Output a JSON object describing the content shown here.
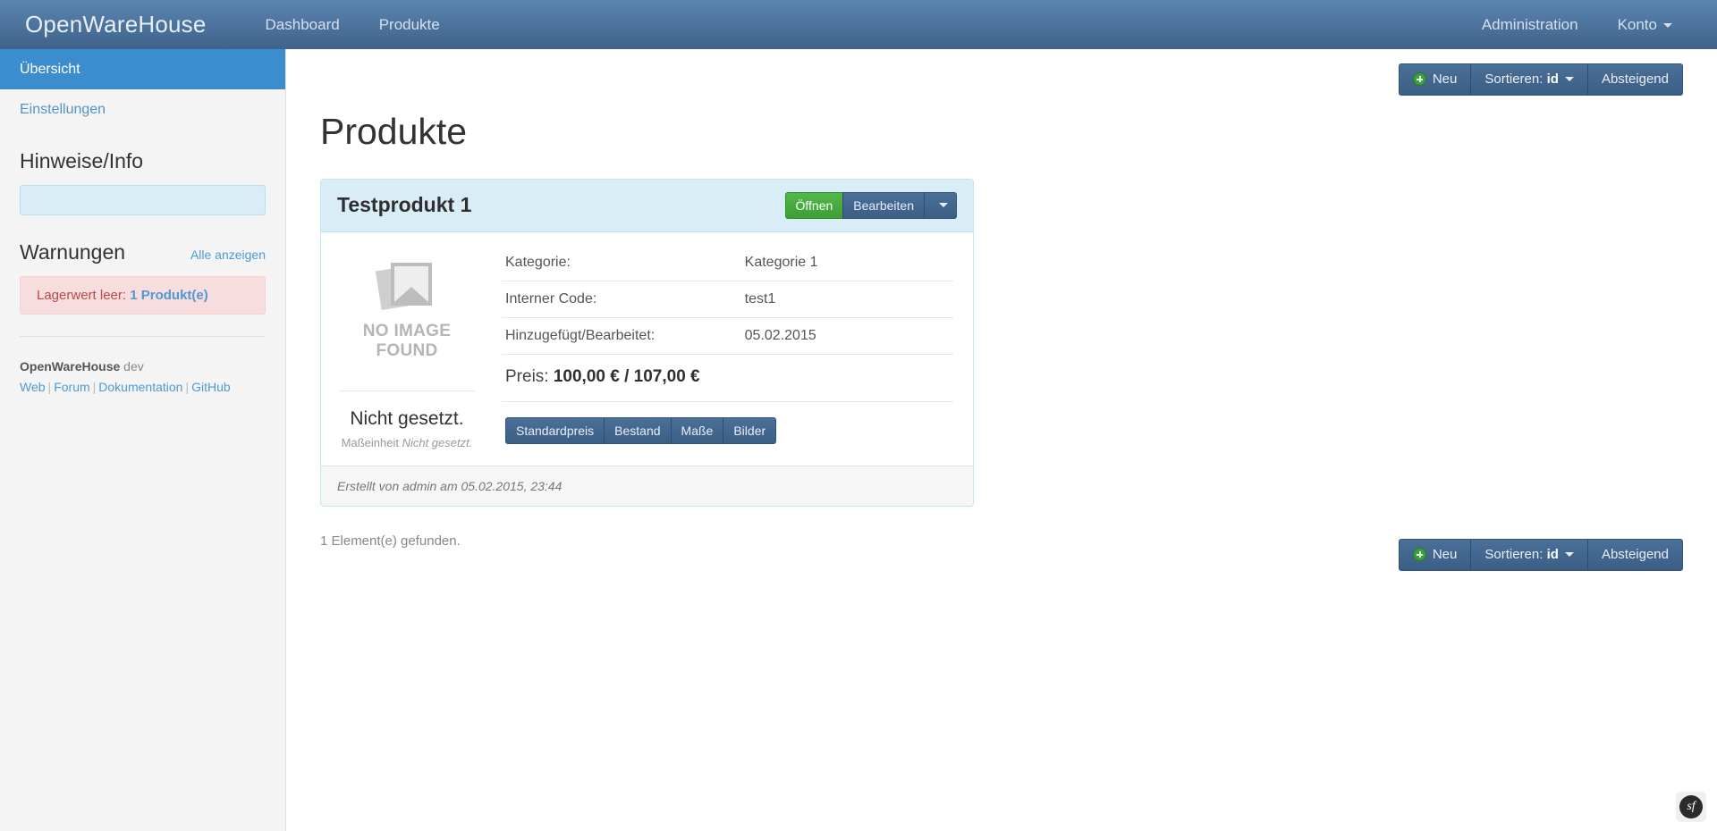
{
  "navbar": {
    "brand": "OpenWareHouse",
    "links": [
      {
        "label": "Dashboard"
      },
      {
        "label": "Produkte"
      }
    ],
    "right_links": [
      {
        "label": "Administration"
      },
      {
        "label": "Konto"
      }
    ],
    "brand_color": "#3f628a"
  },
  "sidebar": {
    "nav": [
      {
        "label": "Übersicht",
        "active": true
      },
      {
        "label": "Einstellungen",
        "active": false
      }
    ],
    "info": {
      "heading": "Hinweise/Info",
      "box_text": ""
    },
    "warnings": {
      "heading": "Warnungen",
      "show_all_label": "Alle anzeigen",
      "items": [
        {
          "text": "Lagerwert leer:",
          "link": "1 Produkt(e)"
        }
      ],
      "color": "#b94a48"
    },
    "footer": {
      "app_name": "OpenWareHouse",
      "version": "dev",
      "links": [
        "Web",
        "Forum",
        "Dokumentation",
        "GitHub"
      ]
    }
  },
  "main": {
    "page_title": "Produkte",
    "toolbar": {
      "new_label": "Neu",
      "sort_label": "Sortieren:",
      "sort_value": "id",
      "direction_label": "Absteigend"
    },
    "product": {
      "title": "Testprodukt 1",
      "actions": {
        "open_label": "Öffnen",
        "edit_label": "Bearbeiten"
      },
      "image_placeholder": {
        "line1": "NO IMAGE",
        "line2": "FOUND"
      },
      "measure": {
        "value": "Nicht gesetzt.",
        "unit_label": "Maßeinheit",
        "unit_value": "Nicht gesetzt."
      },
      "info_rows": [
        {
          "label": "Kategorie:",
          "value": "Kategorie 1"
        },
        {
          "label": "Interner Code:",
          "value": "test1"
        },
        {
          "label": "Hinzugefügt/Bearbeitet:",
          "value": "05.02.2015"
        }
      ],
      "price": {
        "label": "Preis:",
        "value": "100,00 € / 107,00 €"
      },
      "tabs": [
        {
          "label": "Standardpreis"
        },
        {
          "label": "Bestand"
        },
        {
          "label": "Maße"
        },
        {
          "label": "Bilder"
        }
      ],
      "footer": "Erstellt von admin am 05.02.2015, 23:44"
    },
    "result_count": "1 Element(e) gefunden."
  },
  "symfony_badge": {
    "label": "sf"
  }
}
